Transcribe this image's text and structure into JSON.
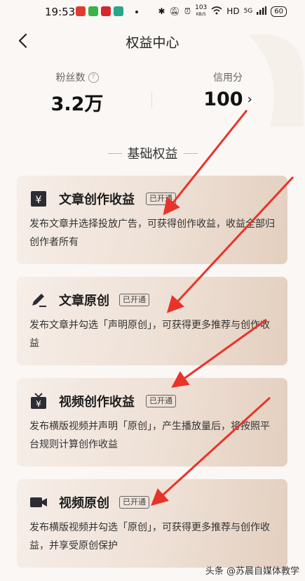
{
  "status_bar": {
    "time": "19:53",
    "speed": "103",
    "speed_unit": "KB/S",
    "network": "HD",
    "signal": "5G",
    "battery": "60"
  },
  "nav": {
    "title": "权益中心"
  },
  "stats": {
    "fans_label": "粉丝数",
    "fans_value": "3.2万",
    "credit_label": "信用分",
    "credit_value": "100"
  },
  "section": {
    "title": "基础权益"
  },
  "cards": [
    {
      "icon": "yen-document-icon",
      "title": "文章创作收益",
      "badge": "已开通",
      "desc": "发布文章并选择投放广告，可获得创作收益，收益全部归创作者所有"
    },
    {
      "icon": "pen-icon",
      "title": "文章原创",
      "badge": "已开通",
      "desc": "发布文章并勾选「声明原创」，可获得更多推荐与创作收益"
    },
    {
      "icon": "tv-yen-icon",
      "title": "视频创作收益",
      "badge": "已开通",
      "desc": "发布横版视频并声明「原创」，产生播放量后，将按照平台规则计算创作收益"
    },
    {
      "icon": "video-camera-icon",
      "title": "视频原创",
      "badge": "已开通",
      "desc": "发布横版视频并勾选「原创」，可获得更多推荐与创作收益，并享受原创保护"
    }
  ],
  "watermark": "头条 @苏晨自媒体教学",
  "colors": {
    "arrow": "#e8332a",
    "card_start": "#f6eee8",
    "card_end": "#e3cfbf"
  }
}
